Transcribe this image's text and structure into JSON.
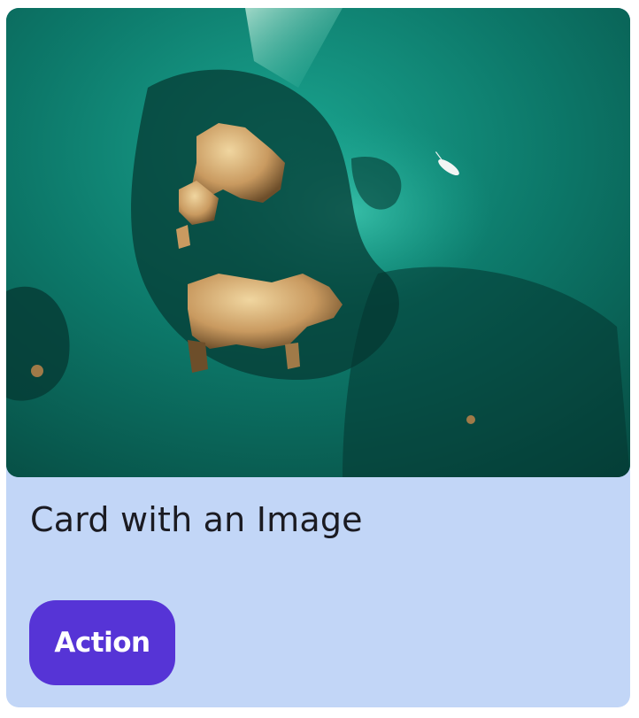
{
  "card": {
    "title": "Card with an Image",
    "image_description_icon": "aerial-island-photo",
    "action_label": "Action",
    "colors": {
      "background": "#c2d6f7",
      "button": "#5634d6",
      "button_text": "#ffffff",
      "title_text": "#1b1b22"
    }
  }
}
